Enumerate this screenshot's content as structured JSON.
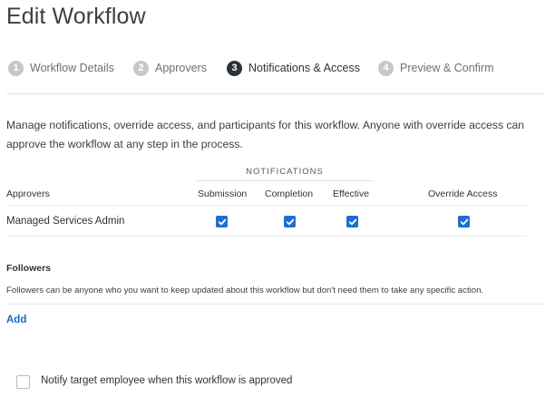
{
  "page": {
    "title": "Edit Workflow"
  },
  "steps": [
    {
      "num": "1",
      "label": "Workflow Details",
      "active": false
    },
    {
      "num": "2",
      "label": "Approvers",
      "active": false
    },
    {
      "num": "3",
      "label": "Notifications & Access",
      "active": true
    },
    {
      "num": "4",
      "label": "Preview & Confirm",
      "active": false
    }
  ],
  "description": "Manage notifications, override access, and participants for this workflow. Anyone with override access can approve the workflow at any step in the process.",
  "table": {
    "group_header": "NOTIFICATIONS",
    "columns": {
      "approvers": "Approvers",
      "submission": "Submission",
      "completion": "Completion",
      "effective": "Effective",
      "override": "Override Access"
    },
    "rows": [
      {
        "name": "Managed Services Admin",
        "submission": true,
        "completion": true,
        "effective": true,
        "override": true
      }
    ]
  },
  "followers": {
    "heading": "Followers",
    "description": "Followers can be anyone who you want to keep updated about this workflow but don't need them to take any specific action.",
    "add_label": "Add"
  },
  "notify": {
    "label": "Notify target employee when this workflow is approved",
    "checked": false
  },
  "colors": {
    "accent": "#1f6fd1",
    "link": "#1a66c8",
    "active_step": "#2e3338",
    "inactive_step": "#c5c8cb"
  }
}
